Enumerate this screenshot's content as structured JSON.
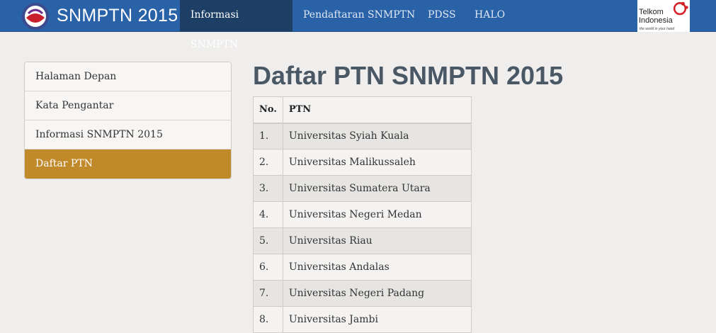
{
  "brand": {
    "title": "SNMPTN 2015"
  },
  "nav": {
    "items": [
      {
        "label": "Informasi SNMPTN",
        "active": true
      },
      {
        "label": "Pendaftaran SNMPTN",
        "active": false
      },
      {
        "label": "PDSS",
        "active": false
      },
      {
        "label": "HALO",
        "active": false
      }
    ]
  },
  "partner": {
    "name_line1": "Telkom",
    "name_line2": "Indonesia",
    "tagline": "the world in your hand"
  },
  "sidebar": {
    "items": [
      {
        "label": "Halaman Depan"
      },
      {
        "label": "Kata Pengantar"
      },
      {
        "label": "Informasi SNMPTN 2015"
      },
      {
        "label": "Daftar PTN",
        "active": true
      }
    ]
  },
  "main": {
    "title": "Daftar PTN SNMPTN 2015",
    "table": {
      "headers": [
        "No.",
        "PTN"
      ],
      "rows": [
        [
          "1.",
          "Universitas Syiah Kuala"
        ],
        [
          "2.",
          "Universitas Malikussaleh"
        ],
        [
          "3.",
          "Universitas Sumatera Utara"
        ],
        [
          "4.",
          "Universitas Negeri Medan"
        ],
        [
          "5.",
          "Universitas Riau"
        ],
        [
          "6.",
          "Universitas Andalas"
        ],
        [
          "7.",
          "Universitas Negeri Padang"
        ],
        [
          "8.",
          "Universitas Jambi"
        ]
      ]
    }
  },
  "colors": {
    "navbar": "#2a62a8",
    "nav_active": "#1d3f66",
    "sidebar_active": "#c0892a",
    "title": "#4a5866"
  }
}
